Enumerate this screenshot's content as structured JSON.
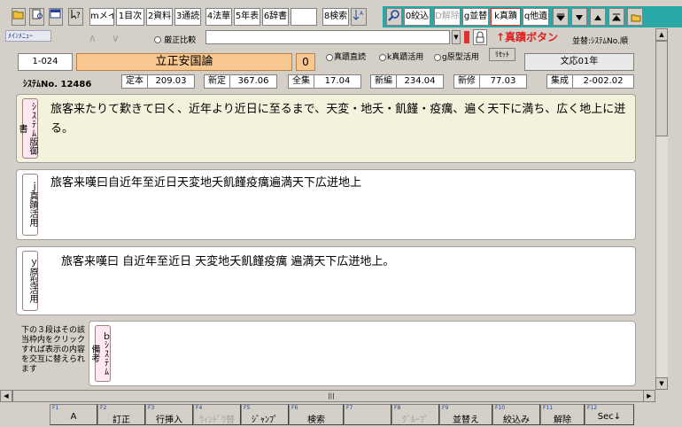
{
  "toolbar": {
    "buttons": [
      "",
      "",
      "",
      "",
      "mメイン",
      "1目次",
      "2資料",
      "3通読",
      "4法華",
      "5年表",
      "6辞書",
      "",
      "8検索",
      "",
      "",
      "0絞込",
      "D解除",
      "g並替",
      "k真蹟",
      "q他遺",
      "",
      "",
      "",
      "",
      ""
    ]
  },
  "row2": {
    "menu_label": "ﾒｲﾝﾒﾆｭｰ",
    "nav_back": "∧",
    "nav_fwd": "∨",
    "compare_label": "厳正比較",
    "compare_value": "",
    "annotation": "↑真蹟ボタン",
    "sort_label": "並替:ｼｽﾃﾑNo.順"
  },
  "doc": {
    "code": "1-024",
    "title": "立正安国論",
    "number": "0",
    "radio1": "真蹟直読",
    "radio2": "k真蹟活用",
    "radio3": "g原型活用",
    "reset": "ﾘｾｯﾄ",
    "era": "文応01年"
  },
  "stats": {
    "sys_label": "ｼｽﾃﾑNo. 12486",
    "teihon_label": "定本",
    "teihon_value": "209.03",
    "shintei_label": "新定",
    "shintei_value": "367.06",
    "zenshu_label": "全集",
    "zenshu_value": "17.04",
    "shinpen_label": "新編",
    "shinpen_value": "234.04",
    "shinshu_label": "新修",
    "shinshu_value": "77.03",
    "shusei_label": "集成",
    "shusei_value": "2-002.02"
  },
  "panels": {
    "p1_label": "ｼｽﾃﾑ版御書",
    "p1_text": "旅客来たりて歎きて曰く、近年より近日に至るまで、天変・地夭・飢饉・疫癘、遍く天下に満ち、広く地上に迸る。",
    "p2_label": "ｊ真蹟活用",
    "p2_text": "旅客来嘆曰自近年至近日天変地夭飢饉疫癘遍満天下広迸地上",
    "p3_label": "ｙ原型活用",
    "p3_text": "旅客来嘆曰 自近年至近日 天変地夭飢饉疫癘 遍満天下広迸地上。",
    "note": "下の３段はその該当枠内をクリックすれば表示の内容を交互に替えられます",
    "p4_label": "ｂｼｽﾃﾑ備考"
  },
  "fkeys": [
    {
      "fn": "F1",
      "label": "A"
    },
    {
      "fn": "F2",
      "label": "訂正"
    },
    {
      "fn": "F3",
      "label": "行挿入"
    },
    {
      "fn": "F4",
      "label": "ｳｨﾝﾄﾞｳ替"
    },
    {
      "fn": "F5",
      "label": "ｼﾞｬﾝﾌﾟ"
    },
    {
      "fn": "F6",
      "label": "検索"
    },
    {
      "fn": "F7",
      "label": ""
    },
    {
      "fn": "F8",
      "label": "ｸﾞﾙｰﾌﾟ"
    },
    {
      "fn": "F9",
      "label": "並替え"
    },
    {
      "fn": "F10",
      "label": "絞込み"
    },
    {
      "fn": "F11",
      "label": "解除"
    },
    {
      "fn": "F12",
      "label": "Sec↓"
    }
  ],
  "colors": {
    "toolbar_accent": "#2aa7a7",
    "title_bg": "#f8c890",
    "annotation": "#e02020",
    "panel_top_bg": "#f4f2dc"
  }
}
